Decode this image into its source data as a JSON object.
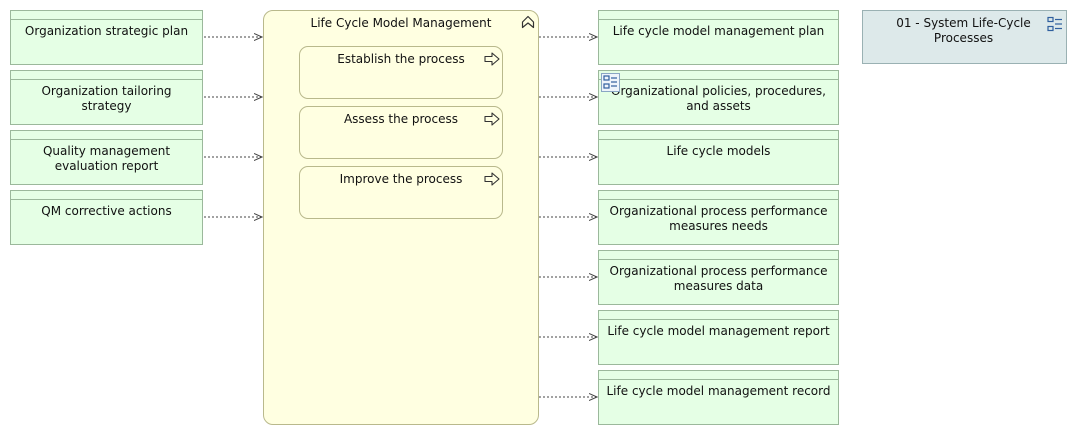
{
  "inputs": [
    {
      "label": "Organization strategic plan"
    },
    {
      "label": "Organization tailoring strategy"
    },
    {
      "label": "Quality management evaluation report"
    },
    {
      "label": "QM corrective actions"
    }
  ],
  "container": {
    "title": "Life Cycle Model Management",
    "icon": "function-chevron-icon",
    "processes": [
      {
        "label": "Establish the process",
        "icon": "process-arrow-icon"
      },
      {
        "label": "Assess the process",
        "icon": "process-arrow-icon"
      },
      {
        "label": "Improve the process",
        "icon": "process-arrow-icon"
      }
    ]
  },
  "outputs": [
    {
      "label": "Life cycle model management plan"
    },
    {
      "label": "Organizational policies, procedures, and assets"
    },
    {
      "label": "Life cycle models"
    },
    {
      "label": "Organizational process performance measures needs"
    },
    {
      "label": "Organizational process performance measures data"
    },
    {
      "label": "Life cycle model management report"
    },
    {
      "label": "Life cycle model management record"
    }
  ],
  "grouping": {
    "label": "01 - System Life-Cycle Processes",
    "icon": "grouping-tree-icon"
  },
  "colors": {
    "object_fill": "#e5ffe5",
    "container_fill": "#ffffe1",
    "grouping_fill": "#dde9ea",
    "connector": "#444444"
  }
}
